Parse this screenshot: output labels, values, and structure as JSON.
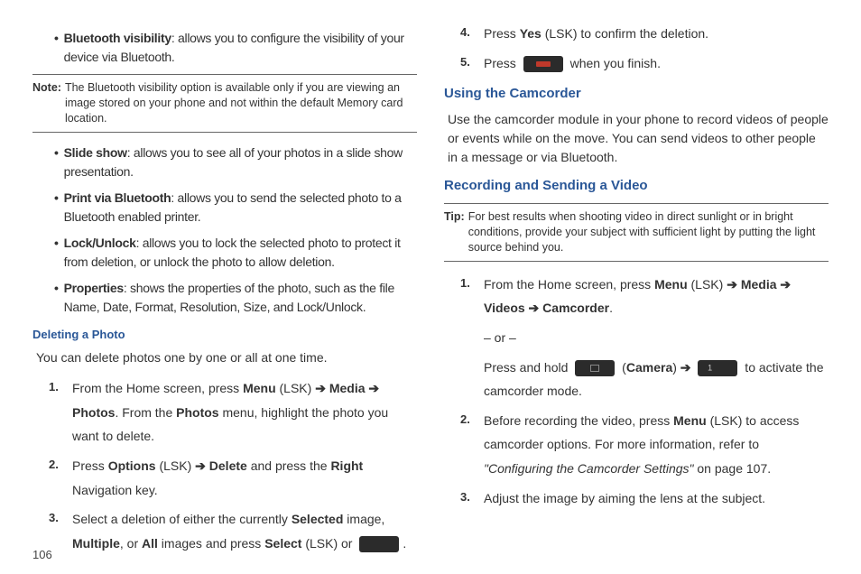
{
  "left": {
    "bt_visibility_label": "Bluetooth visibility",
    "bt_visibility_text": ": allows you to configure the visibility of your device via Bluetooth.",
    "note_label": "Note:",
    "note_text": "The Bluetooth visibility option is available only if you are viewing an image stored on your phone and not within the default Memory card location.",
    "slide_label": "Slide show",
    "slide_text": ": allows you to see all of your photos in a slide show presentation.",
    "print_label": "Print via Bluetooth",
    "print_text": ": allows you to send the selected photo to a Bluetooth enabled printer.",
    "lock_label": "Lock/Unlock",
    "lock_text": ": allows you to lock the selected photo to protect it from deletion, or unlock the photo to allow deletion.",
    "props_label": "Properties",
    "props_text": ": shows the properties of the photo, such as the file Name, Date, Format, Resolution, Size, and Lock/Unlock.",
    "delete_heading": "Deleting a Photo",
    "delete_intro": "You can delete photos one by one or all at one time.",
    "step1a": "From the Home screen, press ",
    "menu": "Menu",
    "lsk": " (LSK) ",
    "arrow": "➔",
    "media": " Media ",
    "photos": "Photos",
    "step1b": ". From the ",
    "photos2": "Photos",
    "step1c": " menu, highlight the photo you want to delete.",
    "step2a": "Press ",
    "options": "Options",
    "step2b": " (LSK) ",
    "delete": " Delete",
    "step2c": " and press the ",
    "right": "Right",
    "step2d": " Navigation key.",
    "step3a": "Select a deletion of either the currently ",
    "selected": "Selected",
    "step3b": " image, ",
    "multiple": "Multiple",
    "step3c": ", or ",
    "all": "All",
    "step3d": " images and press ",
    "select": "Select",
    "step3e": " (LSK) or ",
    "step3f": "."
  },
  "right": {
    "step4a": "Press ",
    "yes": "Yes",
    "step4b": " (LSK) to confirm the deletion.",
    "step5a": "Press ",
    "step5b": " when you finish.",
    "camcorder_heading": "Using the Camcorder",
    "camcorder_text": "Use the camcorder module in your phone to record videos of people or events while on the move. You can send videos to other people in a message or via Bluetooth.",
    "recording_heading": "Recording and Sending a Video",
    "tip_label": "Tip:",
    "tip_text": "For best results when shooting video in direct sunlight or in bright conditions, provide your subject with sufficient light by putting the light source behind you.",
    "r1a": "From the Home screen, press ",
    "menu": "Menu",
    "lsk": " (LSK) ",
    "arrow": "➔",
    "media": " Media ",
    "videos": "Videos ",
    "camcorder": " Camcorder",
    "r1b": ".",
    "or": "– or –",
    "r1c": "Press and hold ",
    "camera": "Camera",
    "r1d": " to activate the camcorder mode.",
    "r2a": "Before recording the video, press ",
    "r2b": " (LSK) to access camcorder options. For more information, refer to ",
    "r2c": "\"Configuring the Camcorder Settings\" ",
    "r2d": " on page 107.",
    "r3": "Adjust the image by aiming the lens at the subject."
  },
  "page": "106"
}
